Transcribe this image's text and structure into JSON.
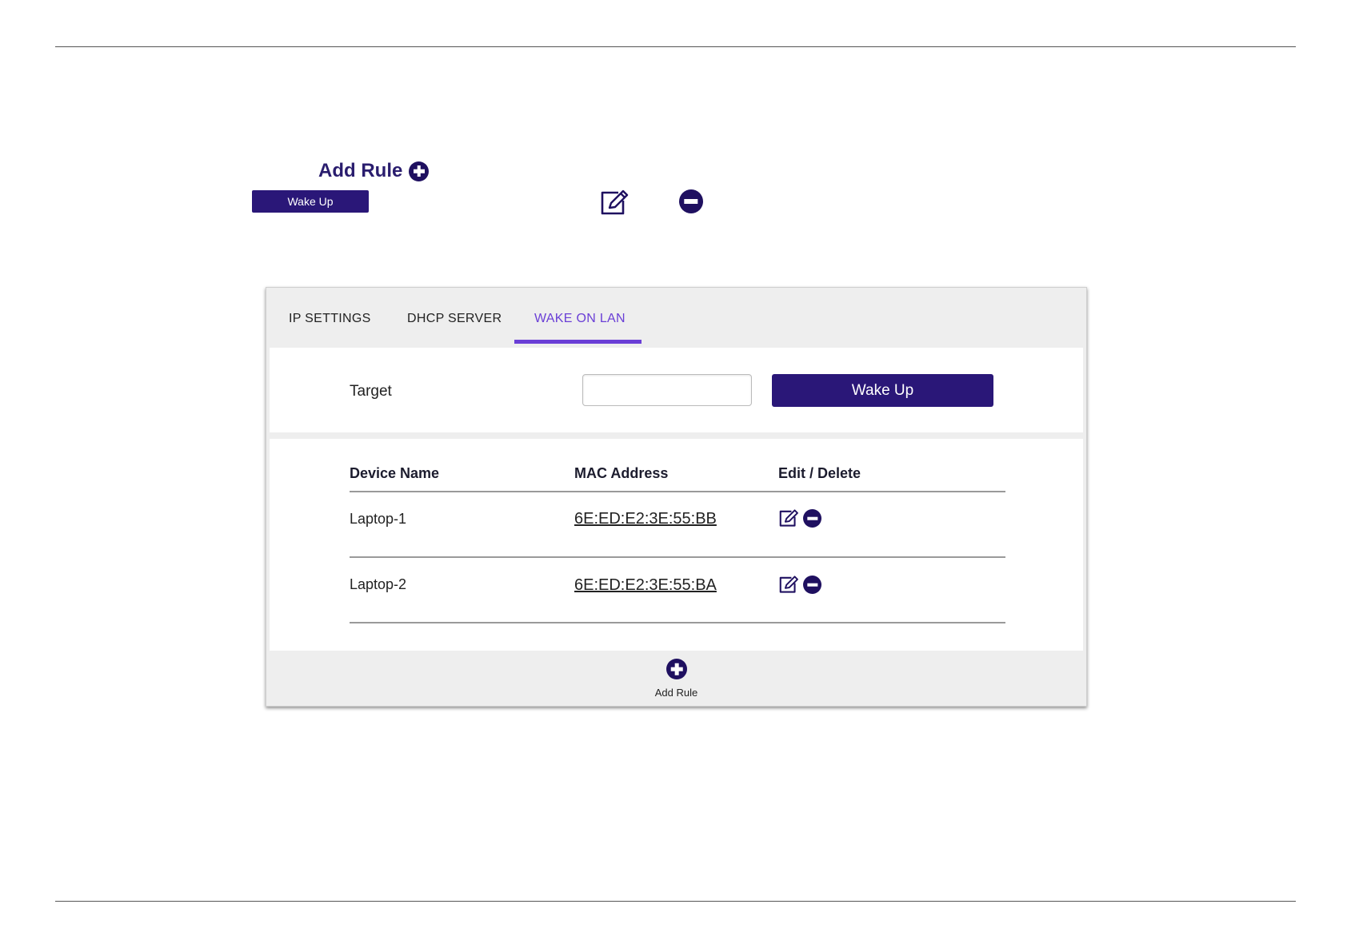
{
  "legend": {
    "add_rule_label": "Add Rule",
    "wake_up_label": "Wake Up"
  },
  "tabs": [
    {
      "label": "IP SETTINGS",
      "active": false
    },
    {
      "label": "DHCP SERVER",
      "active": false
    },
    {
      "label": "WAKE ON LAN",
      "active": true
    }
  ],
  "target": {
    "label": "Target",
    "value": "",
    "button_label": "Wake Up"
  },
  "table": {
    "headers": [
      "Device Name",
      "MAC Address",
      "Edit / Delete"
    ],
    "rows": [
      {
        "device_name": "Laptop-1",
        "mac": "6E:ED:E2:3E:55:BB"
      },
      {
        "device_name": "Laptop-2",
        "mac": "6E:ED:E2:3E:55:BA"
      }
    ]
  },
  "footer": {
    "add_rule_label": "Add Rule"
  },
  "colors": {
    "primary": "#2a1778",
    "accent": "#6a3fd6",
    "icon": "#1f1060"
  },
  "icons": {
    "add": "plus-circle-icon",
    "edit": "edit-square-icon",
    "delete": "minus-circle-icon"
  }
}
